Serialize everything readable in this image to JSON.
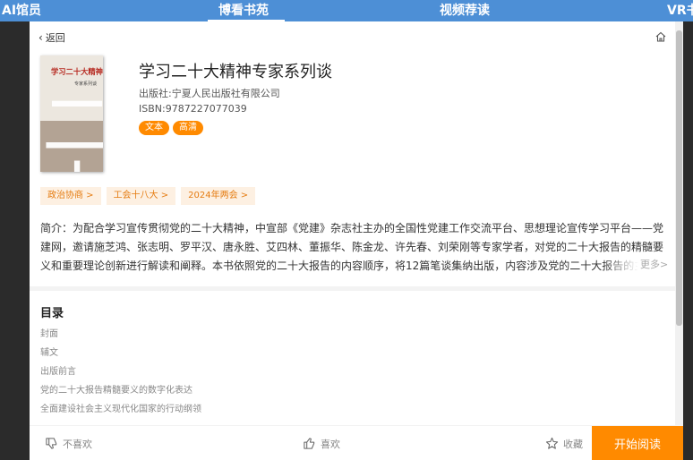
{
  "topnav": {
    "ai": "AI馆员",
    "boke": "博看书苑",
    "video": "视频荐读",
    "vr": "VR书"
  },
  "panel": {
    "back_label": "返回",
    "icons": {
      "back": "chevron-left-icon",
      "home": "home-icon"
    }
  },
  "book": {
    "cover_title": "学习二十大精神",
    "cover_subtitle": "专家系列谈",
    "cover_glyph": "二十大",
    "title": "学习二十大精神专家系列谈",
    "publisher": "出版社:宁夏人民出版社有限公司",
    "isbn": "ISBN:9787227077039",
    "badges": [
      "文本",
      "高清"
    ]
  },
  "tags": [
    "政治协商 >",
    "工会十八大 >",
    "2024年两会 >"
  ],
  "intro": {
    "text": "简介：为配合学习宣传贯彻党的二十大精神，中宣部《党建》杂志社主办的全国性党建工作交流平台、思想理论宣传学习平台——党建网，邀请施芝鸿、张志明、罗平汉、唐永胜、艾四林、董振华、陈金龙、许先春、刘荣刚等专家学者，对党的二十大报告的精髓要义和重要理论创新进行解读和阐释。本书依照党的二十大报告的内容顺序，将12篇笔谈集纳出版，内容涉及党的二十大报告的主题与内涵",
    "more_label": "更多>"
  },
  "toc": {
    "title": "目录",
    "items": [
      "封面",
      "辅文",
      "出版前言",
      "党的二十大报告精髓要义的数字化表达",
      "全面建设社会主义现代化国家的行动纲领"
    ]
  },
  "bottombar": {
    "dislike": "不喜欢",
    "like": "喜欢",
    "favorite": "收藏",
    "start": "开始阅读",
    "icons": {
      "dislike": "thumbs-down-icon",
      "like": "thumbs-up-icon",
      "favorite": "star-icon"
    }
  },
  "colors": {
    "nav": "#4d8fd6",
    "accent": "#ff8a00",
    "tag_bg": "#fdf0e2"
  }
}
